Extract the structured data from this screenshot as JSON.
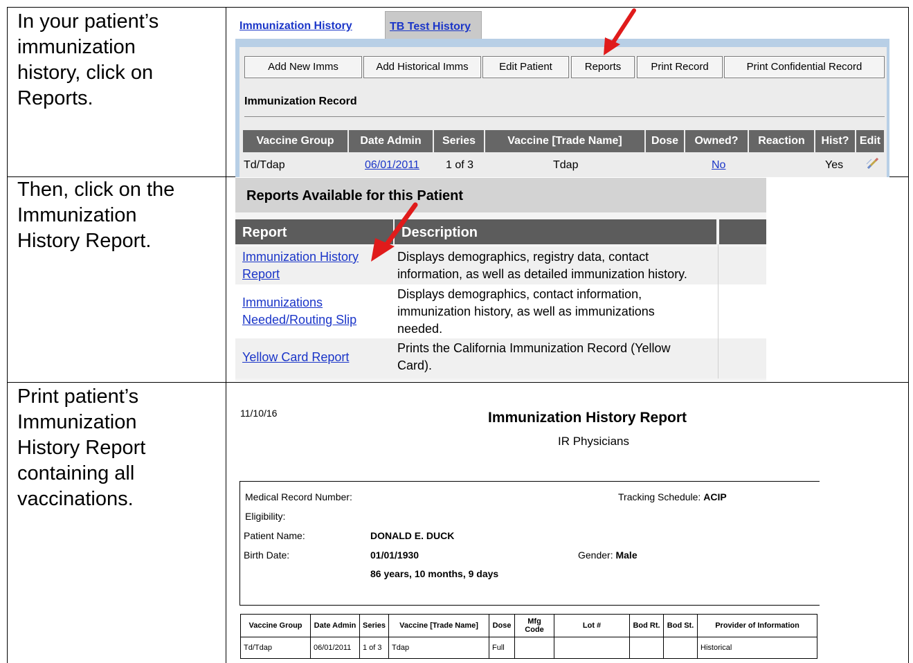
{
  "instructions": [
    [
      "In your patient’s",
      "immunization",
      "history, click on",
      "Reports."
    ],
    [
      "Then, click on the",
      "Immunization",
      "History Report."
    ],
    [
      "Print patient’s",
      "Immunization",
      "History Report",
      "containing all",
      "vaccinations."
    ]
  ],
  "history_screen": {
    "tabs": [
      "Immunization History",
      "TB Test History"
    ],
    "buttons": [
      "Add New Imms",
      "Add Historical Imms",
      "Edit Patient",
      "Reports",
      "Print Record",
      "Print Confidential Record"
    ],
    "record_title": "Immunization Record",
    "columns": [
      "Vaccine Group",
      "Date Admin",
      "Series",
      "Vaccine [Trade Name]",
      "Dose",
      "Owned?",
      "Reaction",
      "Hist?",
      "Edit"
    ],
    "row": {
      "vaccine_group": "Td/Tdap",
      "date_admin": "06/01/2011",
      "series": "1 of 3",
      "trade_name": "Tdap",
      "dose": "",
      "owned": "No",
      "reaction": "",
      "hist": "Yes",
      "edit_icon": "pencil-icon"
    }
  },
  "reports_screen": {
    "heading": "Reports Available for this Patient",
    "columns": [
      "Report",
      "Description"
    ],
    "rows": [
      {
        "link": [
          "Immunization History",
          "Report"
        ],
        "desc": [
          "Displays demographics, registry data, contact",
          "information, as well as detailed immunization history."
        ]
      },
      {
        "link": [
          "Immunizations",
          "Needed/Routing Slip"
        ],
        "desc": [
          "Displays demographics, contact information,",
          "immunization history, as well as immunizations",
          "needed."
        ]
      },
      {
        "link": [
          "Yellow Card Report"
        ],
        "desc": [
          "Prints the California Immunization Record (Yellow",
          "Card)."
        ]
      }
    ]
  },
  "printed_report": {
    "date": "11/10/16",
    "title": "Immunization History Report",
    "subtitle": "IR Physicians",
    "medical_record_label": "Medical Record Number:",
    "tracking_label": "Tracking Schedule:",
    "tracking_value": "ACIP",
    "eligibility_label": "Eligibility:",
    "patient_name_label": "Patient Name:",
    "patient_name": "DONALD E. DUCK",
    "birth_date_label": "Birth Date:",
    "birth_date": "01/01/1930",
    "gender_label": "Gender:",
    "gender": "Male",
    "age": "86 years, 10 months, 9 days",
    "columns": [
      "Vaccine Group",
      "Date Admin",
      "Series",
      "Vaccine [Trade Name]",
      "Dose",
      "Mfg Code",
      "Lot #",
      "Bod Rt.",
      "Bod St.",
      "Provider of Information"
    ],
    "rows": [
      [
        "Td/Tdap",
        "06/01/2011",
        "1 of 3",
        "Tdap",
        "Full",
        "",
        "",
        "",
        "",
        "Historical"
      ]
    ]
  },
  "colors": {
    "link": "#1a35c8",
    "arrow": "#e01b1b",
    "header_gray": "#666666",
    "panel_blue": "#b8cfe6"
  }
}
